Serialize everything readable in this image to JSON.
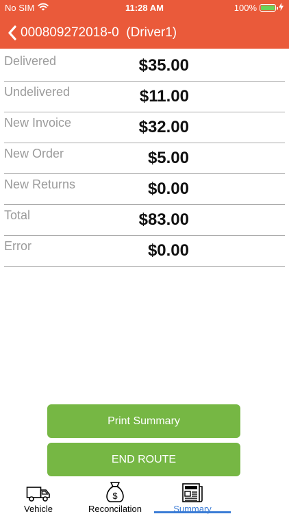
{
  "status_bar": {
    "carrier": "No SIM",
    "time": "11:28 AM",
    "battery": "100%"
  },
  "header": {
    "title": "000809272018-0  (Driver1)",
    "accent_color": "#ea5a3a"
  },
  "summary_rows": [
    {
      "label": "Delivered",
      "value": "$35.00"
    },
    {
      "label": "Undelivered",
      "value": "$11.00"
    },
    {
      "label": "New Invoice",
      "value": "$32.00"
    },
    {
      "label": "New Order",
      "value": "$5.00"
    },
    {
      "label": "New Returns",
      "value": "$0.00"
    },
    {
      "label": "Total",
      "value": "$83.00"
    },
    {
      "label": "Error",
      "value": "$0.00"
    }
  ],
  "buttons": {
    "print_summary": "Print Summary",
    "end_route": "END ROUTE",
    "color": "#76b744"
  },
  "tabs": [
    {
      "label": "Vehicle",
      "icon": "truck-icon"
    },
    {
      "label": "Reconcilation",
      "icon": "money-bag-icon"
    },
    {
      "label": "Summary",
      "icon": "newspaper-icon",
      "active": true
    }
  ],
  "active_tab_color": "#3a7bd5"
}
